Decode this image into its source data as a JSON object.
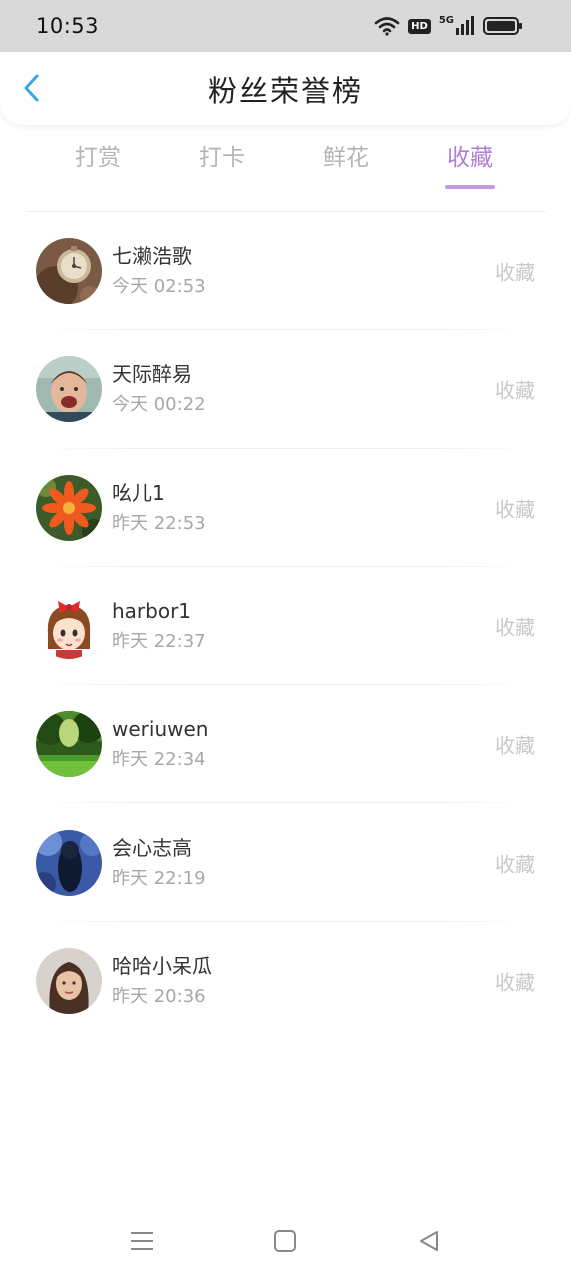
{
  "status_bar": {
    "time": "10:53",
    "hd_label": "HD",
    "network_label": "5G",
    "icons": [
      "wifi-icon",
      "hd-icon",
      "signal-5g-icon",
      "battery-icon"
    ]
  },
  "header": {
    "title": "粉丝荣誉榜",
    "back_icon": "chevron-left-icon"
  },
  "tabs": [
    {
      "label": "打赏",
      "active": false
    },
    {
      "label": "打卡",
      "active": false
    },
    {
      "label": "鲜花",
      "active": false
    },
    {
      "label": "收藏",
      "active": true
    }
  ],
  "fans": [
    {
      "name": "七濑浩歌",
      "time": "今天 02:53",
      "action": "收藏",
      "avatar": "pocket-watch-avatar"
    },
    {
      "name": "天际醉易",
      "time": "今天 00:22",
      "action": "收藏",
      "avatar": "laughing-child-avatar"
    },
    {
      "name": "吆儿1",
      "time": "昨天 22:53",
      "action": "收藏",
      "avatar": "orange-flower-avatar"
    },
    {
      "name": "harbor1",
      "time": "昨天 22:37",
      "action": "收藏",
      "avatar": "cartoon-girl-avatar"
    },
    {
      "name": "weriuwen",
      "time": "昨天 22:34",
      "action": "收藏",
      "avatar": "green-forest-avatar"
    },
    {
      "name": "会心志高",
      "time": "昨天 22:19",
      "action": "收藏",
      "avatar": "dark-blue-silhouette-avatar"
    },
    {
      "name": "哈哈小呆瓜",
      "time": "昨天 20:36",
      "action": "收藏",
      "avatar": "girl-portrait-avatar"
    }
  ],
  "colors": {
    "accent": "#b07fd6",
    "back_icon": "#3aa6e0",
    "inactive_tab": "#b5b5b5",
    "status_bar_bg": "#d9d9d9"
  },
  "nav_bar": {
    "icons": [
      "menu-icon",
      "home-square-icon",
      "back-triangle-icon"
    ]
  }
}
